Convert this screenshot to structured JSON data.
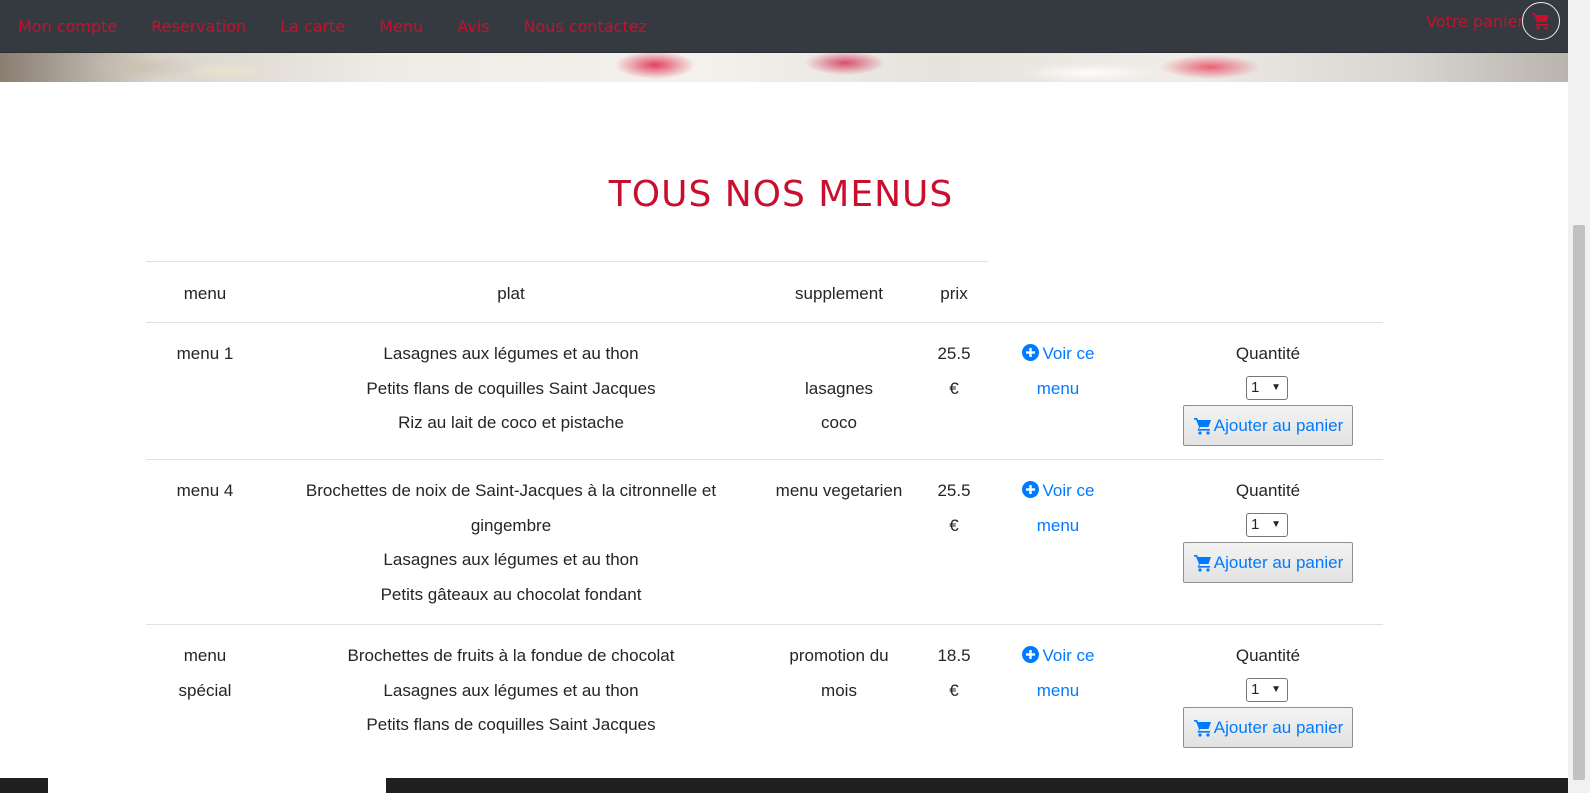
{
  "nav": {
    "links": [
      "Mon compte",
      "Reservation",
      "La carte",
      "Menu",
      "Avis",
      "Nous contactez"
    ],
    "cart_label": "Votre panier",
    "cart_icon": "shopping-cart-icon"
  },
  "page": {
    "title": "TOUS NOS MENUS"
  },
  "table": {
    "headers": {
      "menu": "menu",
      "plat": "plat",
      "supplement": "supplement",
      "prix": "prix"
    },
    "rows": [
      {
        "menu_lines": [
          "menu 1"
        ],
        "plats": [
          "Lasagnes aux légumes et au thon",
          "Petits flans de coquilles Saint Jacques",
          "Riz au lait de coco et pistache"
        ],
        "supplement_lines": [
          "",
          "lasagnes",
          "coco"
        ],
        "prix_lines": [
          "25.5",
          "€"
        ],
        "voir_lines": [
          "Voir ce",
          "menu"
        ],
        "quantite_label": "Quantité",
        "quantite_value": "1",
        "add_label": "Ajouter au panier"
      },
      {
        "menu_lines": [
          "menu 4"
        ],
        "plats": [
          "Brochettes de noix de Saint-Jacques à la citronnelle et",
          "gingembre",
          "Lasagnes aux légumes et au thon",
          "Petits gâteaux au chocolat fondant"
        ],
        "supplement_lines": [
          "menu vegetarien"
        ],
        "prix_lines": [
          "25.5",
          "€"
        ],
        "voir_lines": [
          "Voir ce",
          "menu"
        ],
        "quantite_label": "Quantité",
        "quantite_value": "1",
        "add_label": "Ajouter au panier"
      },
      {
        "menu_lines": [
          "menu",
          "spécial"
        ],
        "plats": [
          "Brochettes de fruits à la fondue de chocolat",
          "Lasagnes aux légumes et au thon",
          "Petits flans de coquilles Saint Jacques"
        ],
        "supplement_lines": [
          "promotion du",
          "mois"
        ],
        "prix_lines": [
          "18.5",
          "€"
        ],
        "voir_lines": [
          "Voir ce",
          "menu"
        ],
        "quantite_label": "Quantité",
        "quantite_value": "1",
        "add_label": "Ajouter au panier"
      }
    ]
  },
  "colors": {
    "accent_red": "#c8102e",
    "link_blue": "#007bff",
    "navbar": "#343a40"
  }
}
